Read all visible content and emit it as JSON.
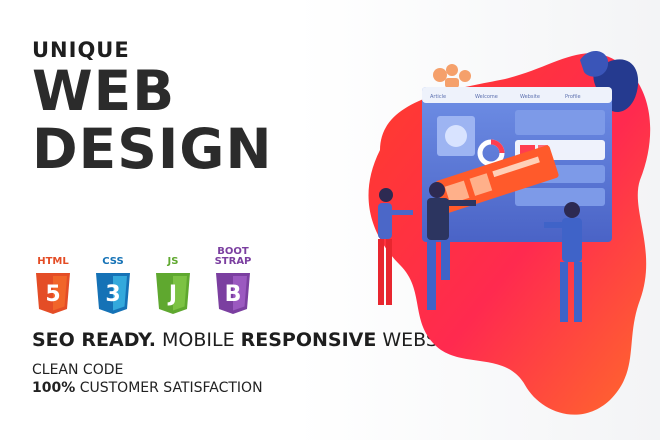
{
  "headline": {
    "small": "UNIQUE",
    "line1": "WEB",
    "line2": "DESIGN"
  },
  "badges": [
    {
      "label": "HTML",
      "digit": "5",
      "color": "#e44d26",
      "shade": "#f16529",
      "icon": "html5-icon"
    },
    {
      "label": "CSS",
      "digit": "3",
      "color": "#1572b6",
      "shade": "#33a9dc",
      "icon": "css3-icon"
    },
    {
      "label": "JS",
      "digit": "J",
      "color": "#5fa82f",
      "shade": "#7cc243",
      "icon": "js-icon"
    },
    {
      "label": "BOOT STRAP",
      "digit": "B",
      "color": "#7b3fa0",
      "shade": "#9b59c0",
      "icon": "bootstrap-icon"
    }
  ],
  "tagline": {
    "part1": "SEO READY.",
    "part2": " MOBILE ",
    "part3": "RESPONSIVE",
    "part4": " WEBSITE"
  },
  "bullets": {
    "line1": "CLEAN CODE",
    "line2_bold": "100%",
    "line2_rest": " CUSTOMER SATISFACTION"
  },
  "browser_tabs": [
    "Article",
    "Welcome",
    "Website",
    "Profile"
  ],
  "colors": {
    "accent_red": "#e8262f",
    "accent_orange": "#ff6a2b",
    "accent_pink": "#ff3d7f",
    "screen_blue": "#5b7bd8",
    "leaf_navy": "#253a8f"
  }
}
